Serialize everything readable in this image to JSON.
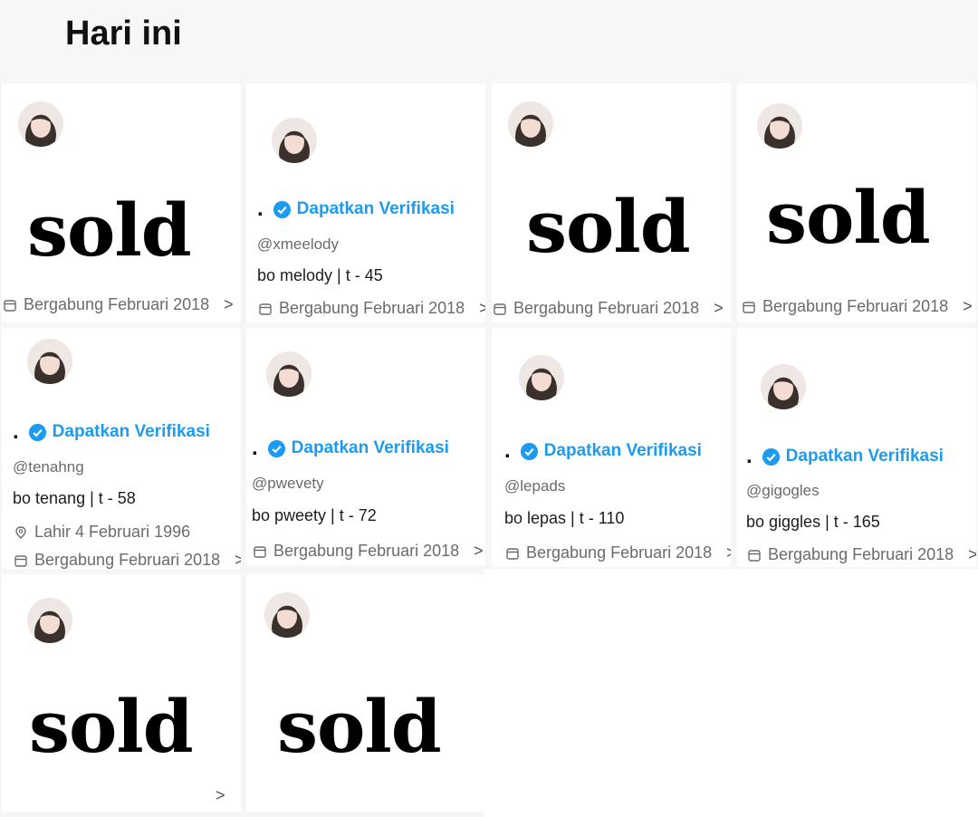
{
  "header": {
    "title": "Hari ini"
  },
  "sold_label": "sold",
  "verify_label": "Dapatkan Verifikasi",
  "dot": ".",
  "joined": "Bergabung Februari 2018",
  "joined_partial": "Bergabung Februari 2018",
  "chevron": ">",
  "cards": {
    "c2": {
      "handle": "@xmeelody",
      "bio": "bo melody | t - 45"
    },
    "c5": {
      "handle": "@tenahng",
      "bio": "bo tenang | t - 58",
      "birth": "Lahir 4 Februari 1996"
    },
    "c6": {
      "handle": "@pwevety",
      "bio": "bo pweety | t - 72"
    },
    "c7": {
      "handle": "@lepads",
      "bio": "bo lepas | t - 110"
    },
    "c8": {
      "handle": "@gigogles",
      "bio": "bo giggles | t - 165"
    }
  },
  "colors": {
    "verified_blue": "#1d9bf0",
    "sold_black": "#000000",
    "background": "#f6f6f6"
  },
  "icons": [
    "avatar",
    "verified-badge-icon",
    "calendar-icon",
    "location-icon",
    "chevron-right-icon"
  ]
}
